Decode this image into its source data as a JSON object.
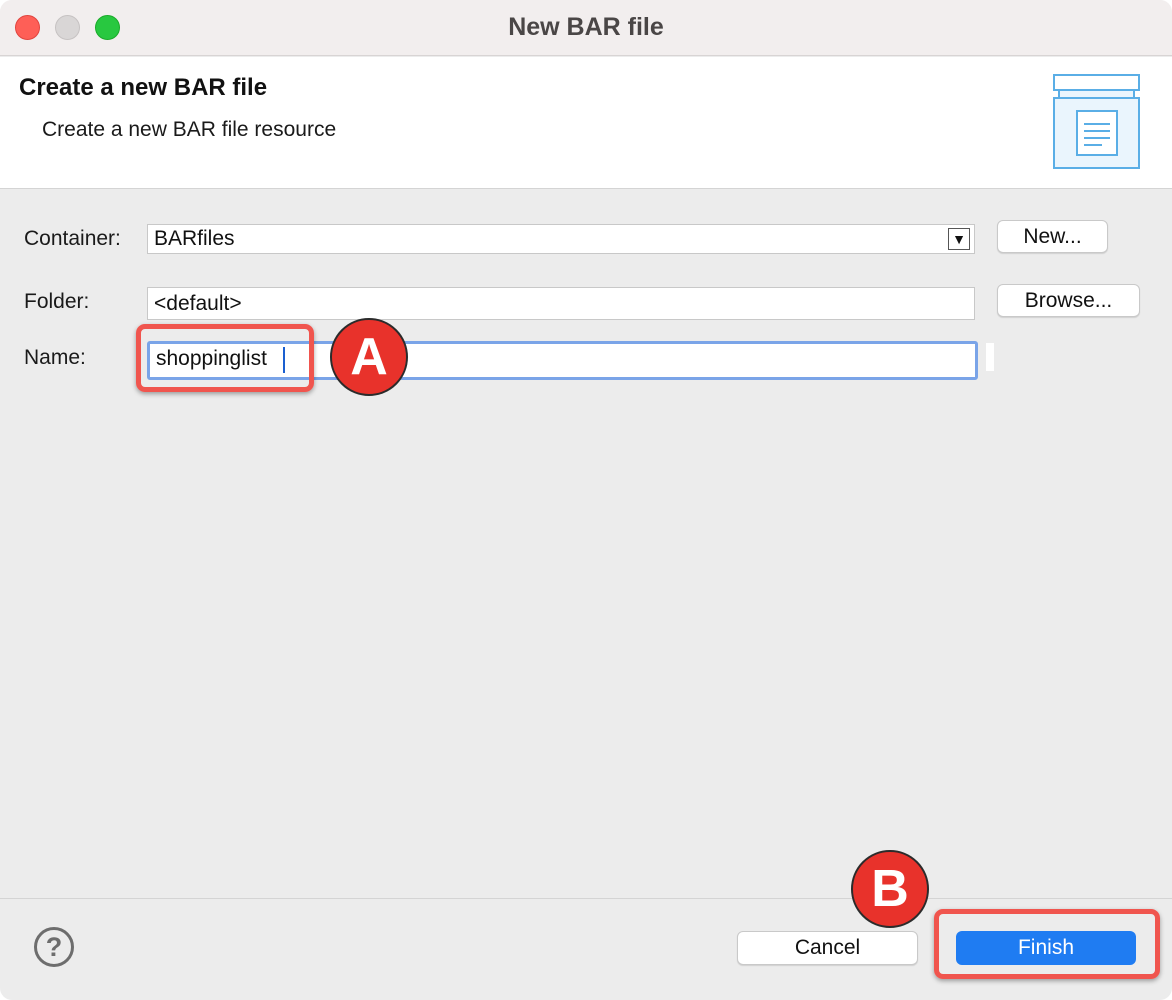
{
  "window": {
    "title": "New BAR file"
  },
  "banner": {
    "title": "Create a new BAR file",
    "subtitle": "Create a new BAR file resource",
    "icon": "bar-file-wizard-icon"
  },
  "form": {
    "container": {
      "label": "Container:",
      "value": "BARfiles",
      "arrow": "▼",
      "button": "New..."
    },
    "folder": {
      "label": "Folder:",
      "value": "<default>",
      "button": "Browse..."
    },
    "name": {
      "label": "Name:",
      "value": "shoppinglist"
    }
  },
  "annotations": {
    "a": "A",
    "b": "B",
    "highlight_color": "#f0554e",
    "badge_color": "#e8322b"
  },
  "footer": {
    "help": "?",
    "cancel": "Cancel",
    "finish": "Finish"
  },
  "colors": {
    "accent": "#1f7cf2",
    "focus_ring": "#7aa4e8"
  }
}
